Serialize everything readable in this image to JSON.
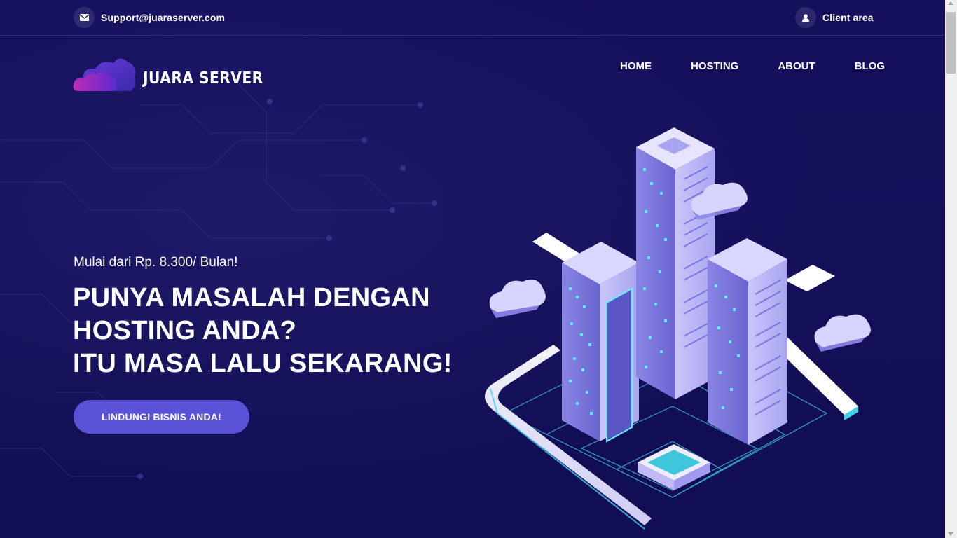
{
  "topbar": {
    "email": "Support@juaraserver.com",
    "email_icon": "envelope-icon",
    "client_area": "Client area",
    "client_icon": "user-icon"
  },
  "logo": {
    "text": "JUARA SERVER",
    "icon": "cloud-logo-icon"
  },
  "nav": {
    "items": [
      {
        "label": "HOME",
        "active": true
      },
      {
        "label": "HOSTING",
        "active": false
      },
      {
        "label": "ABOUT",
        "active": false
      },
      {
        "label": "BLOG",
        "active": false
      }
    ]
  },
  "hero": {
    "subtitle": "Mulai dari Rp. 8.300/ Bulan!",
    "title_lines": [
      "PUNYA MASALAH DENGAN",
      "HOSTING ANDA?",
      "ITU MASA LALU SEKARANG!"
    ],
    "cta_label": "LINDUNGI BISNIS ANDA!"
  },
  "colors": {
    "background": "#14105a",
    "accent": "#5a52d6",
    "cyan": "#5ef0ff"
  }
}
